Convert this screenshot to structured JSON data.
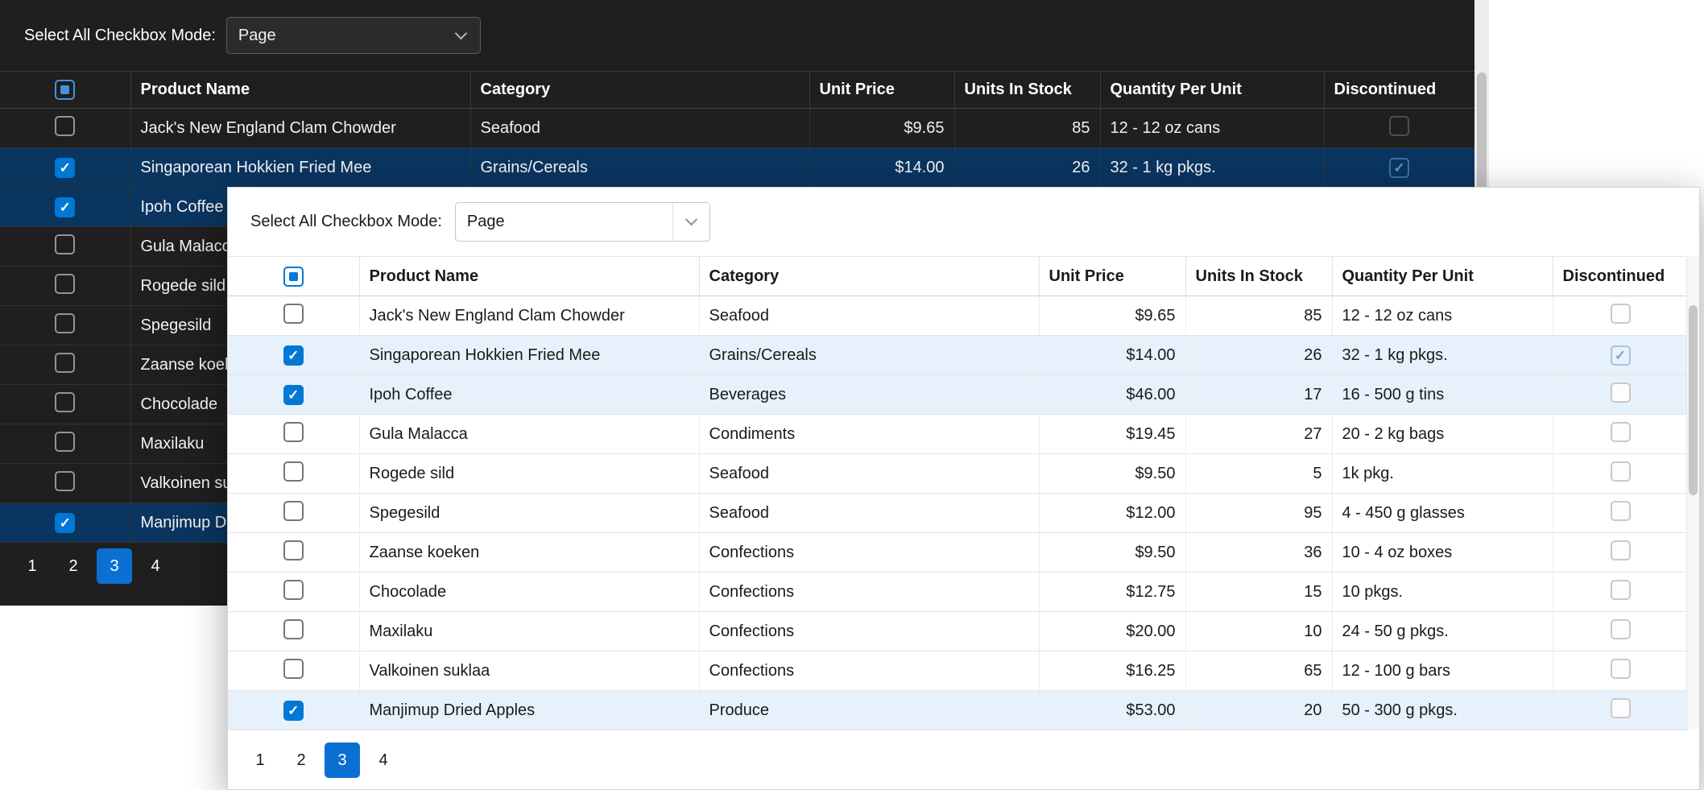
{
  "toolbar": {
    "label": "Select All Checkbox Mode:",
    "mode_value": "Page"
  },
  "grid": {
    "columns": [
      "Product Name",
      "Category",
      "Unit Price",
      "Units In Stock",
      "Quantity Per Unit",
      "Discontinued"
    ],
    "rows": [
      {
        "name": "Jack's New England Clam Chowder",
        "category": "Seafood",
        "price": "$9.65",
        "stock": "85",
        "qty": "12 - 12 oz cans",
        "checked": false,
        "discontinued": false
      },
      {
        "name": "Singaporean Hokkien Fried Mee",
        "category": "Grains/Cereals",
        "price": "$14.00",
        "stock": "26",
        "qty": "32 - 1 kg pkgs.",
        "checked": true,
        "discontinued": true
      },
      {
        "name": "Ipoh Coffee",
        "category": "Beverages",
        "price": "$46.00",
        "stock": "17",
        "qty": "16 - 500 g tins",
        "checked": true,
        "discontinued": false
      },
      {
        "name": "Gula Malacca",
        "category": "Condiments",
        "price": "$19.45",
        "stock": "27",
        "qty": "20 - 2 kg bags",
        "checked": false,
        "discontinued": false
      },
      {
        "name": "Rogede sild",
        "category": "Seafood",
        "price": "$9.50",
        "stock": "5",
        "qty": "1k pkg.",
        "checked": false,
        "discontinued": false
      },
      {
        "name": "Spegesild",
        "category": "Seafood",
        "price": "$12.00",
        "stock": "95",
        "qty": "4 - 450 g glasses",
        "checked": false,
        "discontinued": false
      },
      {
        "name": "Zaanse koeken",
        "category": "Confections",
        "price": "$9.50",
        "stock": "36",
        "qty": "10 - 4 oz boxes",
        "checked": false,
        "discontinued": false
      },
      {
        "name": "Chocolade",
        "category": "Confections",
        "price": "$12.75",
        "stock": "15",
        "qty": "10 pkgs.",
        "checked": false,
        "discontinued": false
      },
      {
        "name": "Maxilaku",
        "category": "Confections",
        "price": "$20.00",
        "stock": "10",
        "qty": "24 - 50 g pkgs.",
        "checked": false,
        "discontinued": false
      },
      {
        "name": "Valkoinen suklaa",
        "category": "Confections",
        "price": "$16.25",
        "stock": "65",
        "qty": "12 - 100 g bars",
        "checked": false,
        "discontinued": false
      },
      {
        "name": "Manjimup Dried Apples",
        "category": "Produce",
        "price": "$53.00",
        "stock": "20",
        "qty": "50 - 300 g pkgs.",
        "checked": true,
        "discontinued": false
      }
    ]
  },
  "pager": {
    "pages": [
      "1",
      "2",
      "3",
      "4"
    ],
    "current": "3"
  },
  "colors": {
    "accent": "#0078d4",
    "pager_current": "#0c6fd4",
    "dark_selected_row": "#0a3560",
    "light_selected_row": "#e7f1fb",
    "dark_background": "#1f1f1f"
  }
}
